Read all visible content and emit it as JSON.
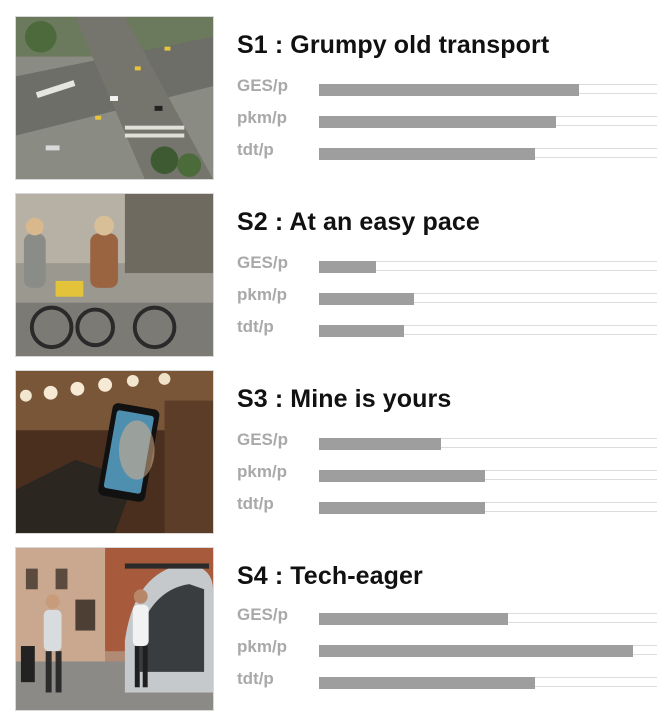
{
  "scenarios": [
    {
      "title": "S1 : Grumpy old transport",
      "image": "city-intersection-aerial-traffic-photo",
      "metrics": [
        {
          "label": "GES/p",
          "value": 0.77
        },
        {
          "label": "pkm/p",
          "value": 0.7
        },
        {
          "label": "tdt/p",
          "value": 0.64
        }
      ]
    },
    {
      "title": "S2 : At an easy pace",
      "image": "two-women-cycling-street-photo",
      "metrics": [
        {
          "label": "GES/p",
          "value": 0.17
        },
        {
          "label": "pkm/p",
          "value": 0.28
        },
        {
          "label": "tdt/p",
          "value": 0.25
        }
      ]
    },
    {
      "title": "S3 : Mine is yours",
      "image": "hand-holding-smartphone-photo",
      "metrics": [
        {
          "label": "GES/p",
          "value": 0.36
        },
        {
          "label": "pkm/p",
          "value": 0.49
        },
        {
          "label": "tdt/p",
          "value": 0.49
        }
      ]
    },
    {
      "title": "S4 : Tech-eager",
      "image": "people-near-autonomous-pod-vehicle-photo",
      "metrics": [
        {
          "label": "GES/p",
          "value": 0.56
        },
        {
          "label": "pkm/p",
          "value": 0.93
        },
        {
          "label": "tdt/p",
          "value": 0.64
        }
      ]
    }
  ],
  "colors": {
    "bar_fill": "#9e9e9e",
    "bar_track": "#dcdcdc",
    "label": "#a9a9a9",
    "title": "#111111"
  }
}
